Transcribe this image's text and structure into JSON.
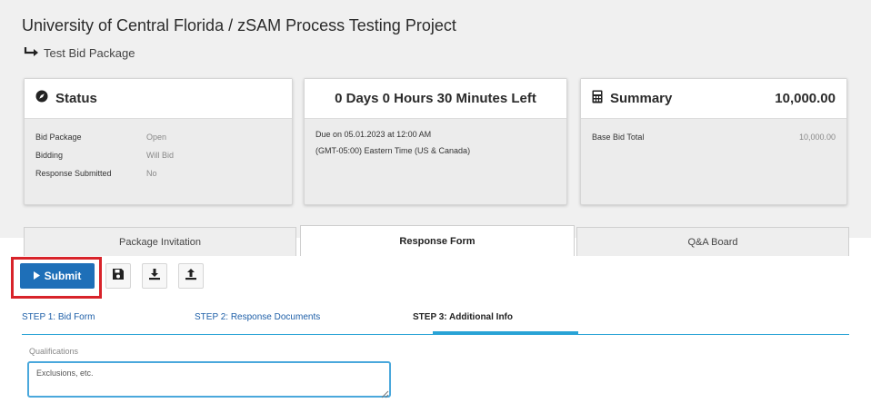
{
  "header": {
    "title": "University of Central Florida / zSAM Process Testing Project",
    "subtitle": "Test Bid Package"
  },
  "status_card": {
    "title": "Status",
    "rows": [
      {
        "label": "Bid Package",
        "value": "Open"
      },
      {
        "label": "Bidding",
        "value": "Will Bid"
      },
      {
        "label": "Response Submitted",
        "value": "No"
      }
    ]
  },
  "timer_card": {
    "title": "0 Days 0 Hours 30 Minutes Left",
    "due_line": "Due on 05.01.2023 at 12:00 AM",
    "timezone_line": "(GMT-05:00) Eastern Time (US & Canada)"
  },
  "summary_card": {
    "title": "Summary",
    "total": "10,000.00",
    "rows": [
      {
        "label": "Base Bid Total",
        "value": "10,000.00"
      }
    ]
  },
  "tabs": [
    {
      "label": "Package Invitation",
      "active": false
    },
    {
      "label": "Response Form",
      "active": true
    },
    {
      "label": "Q&A Board",
      "active": false
    }
  ],
  "toolbar": {
    "submit_label": "Submit",
    "icons": [
      "save-icon",
      "download-icon",
      "upload-icon"
    ]
  },
  "steps": [
    {
      "label": "STEP 1: Bid Form",
      "active": false
    },
    {
      "label": "STEP 2: Response Documents",
      "active": false
    },
    {
      "label": "STEP 3: Additional Info",
      "active": true
    }
  ],
  "qualifications": {
    "label": "Qualifications",
    "value": "Exclusions, etc."
  },
  "colors": {
    "primary": "#1e6fb8",
    "highlight": "#d8232a",
    "accent": "#29a3d6"
  }
}
